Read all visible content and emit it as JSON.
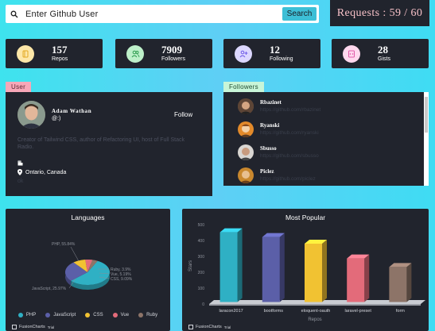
{
  "search": {
    "placeholder": "Enter Github User",
    "button_label": "Search"
  },
  "requests": {
    "label": "Requests : 59 / 60",
    "used": 59,
    "limit": 60
  },
  "stats": [
    {
      "value": "157",
      "label": "Repos",
      "icon": "book-icon",
      "bg": "#fde7a8",
      "color": "#e4a822"
    },
    {
      "value": "7909",
      "label": "Followers",
      "icon": "users-icon",
      "bg": "#bdf0c9",
      "color": "#2d9c4f"
    },
    {
      "value": "12",
      "label": "Following",
      "icon": "user-plus-icon",
      "bg": "#dcd7ff",
      "color": "#6f5ce8"
    },
    {
      "value": "28",
      "label": "Gists",
      "icon": "code-icon",
      "bg": "#ffd8ee",
      "color": "#e05aa9"
    }
  ],
  "user": {
    "tab": "User",
    "name": "Adam Wathan",
    "handle": "@:)",
    "follow_label": "Follow",
    "bio": "Creator of Tailwind CSS, author of Refactoring UI, host of Full Stack Radio.",
    "location": "Ontario, Canada",
    "company": "",
    "extra": "ok"
  },
  "followers": {
    "tab": "Followers",
    "items": [
      {
        "name": "Rbazinet",
        "url": "https://github.com/rbazinet"
      },
      {
        "name": "Ryanski",
        "url": "https://github.com/ryanski"
      },
      {
        "name": "Sbusso",
        "url": "https://github.com/sbusso"
      },
      {
        "name": "Piclez",
        "url": "https://github.com/piclez"
      }
    ]
  },
  "colors": {
    "dark": "#21242d",
    "tab_user": "#f7a7b8",
    "tab_followers": "#c8f5d8"
  },
  "fusion": {
    "brand": "FusionCharts",
    "trial": "Trial"
  },
  "chart_data": [
    {
      "type": "pie",
      "title": "Languages",
      "categories": [
        "PHP",
        "JavaScript",
        "CSS",
        "Vue",
        "Ruby"
      ],
      "values": [
        55.84,
        25.97,
        9.09,
        5.19,
        3.9
      ],
      "labels": [
        "PHP, 55.84%",
        "JavaScript, 25.97%",
        "CSS, 9.09%",
        "Vue, 5.19%",
        "Ruby, 3.9%"
      ],
      "colors": [
        "#2fb0c4",
        "#5b5fa8",
        "#f1c232",
        "#e36b7a",
        "#8d7468"
      ],
      "legend": "bottom"
    },
    {
      "type": "bar",
      "title": "Most Popular",
      "categories": [
        "laracon2017",
        "bootforms",
        "eloquent-oauth",
        "laravel-preset",
        "form"
      ],
      "values": [
        427,
        397,
        355,
        262,
        208
      ],
      "colors": [
        "#2fb0c4",
        "#5b5fa8",
        "#f1c232",
        "#e36b7a",
        "#8d7468"
      ],
      "xlabel": "Repos",
      "ylabel": "Stars",
      "yticks": [
        0,
        100,
        200,
        300,
        400,
        500
      ],
      "ylim": [
        0,
        500
      ]
    }
  ]
}
